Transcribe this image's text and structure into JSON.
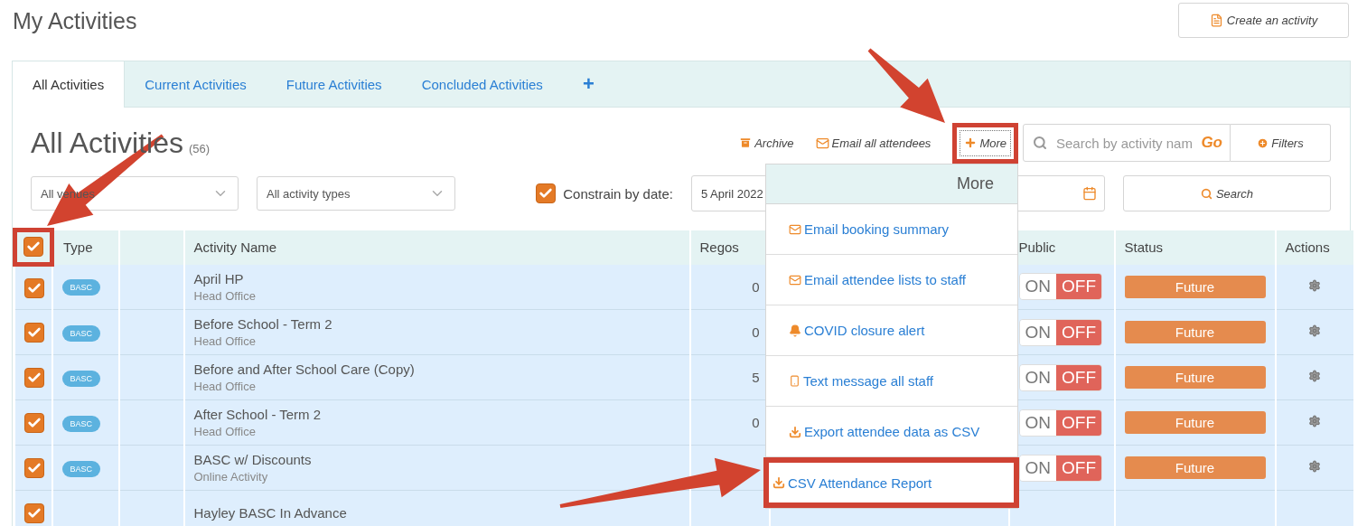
{
  "page_title": "My Activities",
  "create_button": "Create an activity",
  "tabs": [
    {
      "label": "All Activities",
      "selected": true
    },
    {
      "label": "Current Activities",
      "selected": false
    },
    {
      "label": "Future Activities",
      "selected": false
    },
    {
      "label": "Concluded Activities",
      "selected": false
    },
    {
      "label": "+",
      "selected": false
    }
  ],
  "section": {
    "title": "All Activities",
    "count": "(56)"
  },
  "toolbar": {
    "archive": "Archive",
    "email_all": "Email all attendees",
    "more": {
      "label": "More",
      "highlighted": true
    },
    "search": {
      "placeholder": "Search by activity nam",
      "go": "Go"
    },
    "filters": "Filters"
  },
  "filters": {
    "venue": "All venues",
    "activity_type": "All activity types",
    "constrain": {
      "checked": true,
      "label": "Constrain by date:"
    },
    "date_from": "5 April 2022",
    "search_button": "Search"
  },
  "table": {
    "select_all": {
      "checked": true,
      "highlighted": true
    },
    "columns": {
      "type": "Type",
      "name": "Activity Name",
      "regos": "Regos",
      "public": "Public",
      "status": "Status",
      "actions": "Actions"
    },
    "rows": [
      {
        "checked": true,
        "type": "BASC",
        "name": "April HP",
        "venue": "Head Office",
        "regos": "0",
        "public": {
          "on_label": "ON",
          "off_label": "OFF",
          "on": false
        },
        "status": "Future"
      },
      {
        "checked": true,
        "type": "BASC",
        "name": "Before School - Term 2",
        "venue": "Head Office",
        "regos": "0",
        "public": {
          "on_label": "ON",
          "off_label": "OFF",
          "on": false
        },
        "status": "Future"
      },
      {
        "checked": true,
        "type": "BASC",
        "name": "Before and After School Care (Copy)",
        "venue": "Head Office",
        "regos": "5",
        "public": {
          "on_label": "ON",
          "off_label": "OFF",
          "on": false
        },
        "status": "Future"
      },
      {
        "checked": true,
        "type": "BASC",
        "name": "After School - Term 2",
        "venue": "Head Office",
        "regos": "0",
        "public": {
          "on_label": "ON",
          "off_label": "OFF",
          "on": false
        },
        "status": "Future"
      },
      {
        "checked": true,
        "type": "BASC",
        "name": "BASC w/ Discounts",
        "venue": "Online Activity",
        "public": {
          "on_label": "ON",
          "off_label": "OFF",
          "on": false
        },
        "status": "Future"
      },
      {
        "checked": true,
        "name": "Hayley BASC In Advance"
      }
    ]
  },
  "more_menu": {
    "title": "More",
    "items": [
      {
        "kind": "email",
        "label": "Email booking summary",
        "highlighted": false
      },
      {
        "kind": "email",
        "label": "Email attendee lists to staff",
        "highlighted": false
      },
      {
        "kind": "alert",
        "label": "COVID closure alert",
        "highlighted": false
      },
      {
        "kind": "sms",
        "label": "Text message all staff",
        "highlighted": false
      },
      {
        "kind": "download",
        "label": "Export attendee data as CSV",
        "highlighted": false
      },
      {
        "kind": "download",
        "label": "CSV Attendance Report",
        "highlighted": true
      }
    ]
  }
}
